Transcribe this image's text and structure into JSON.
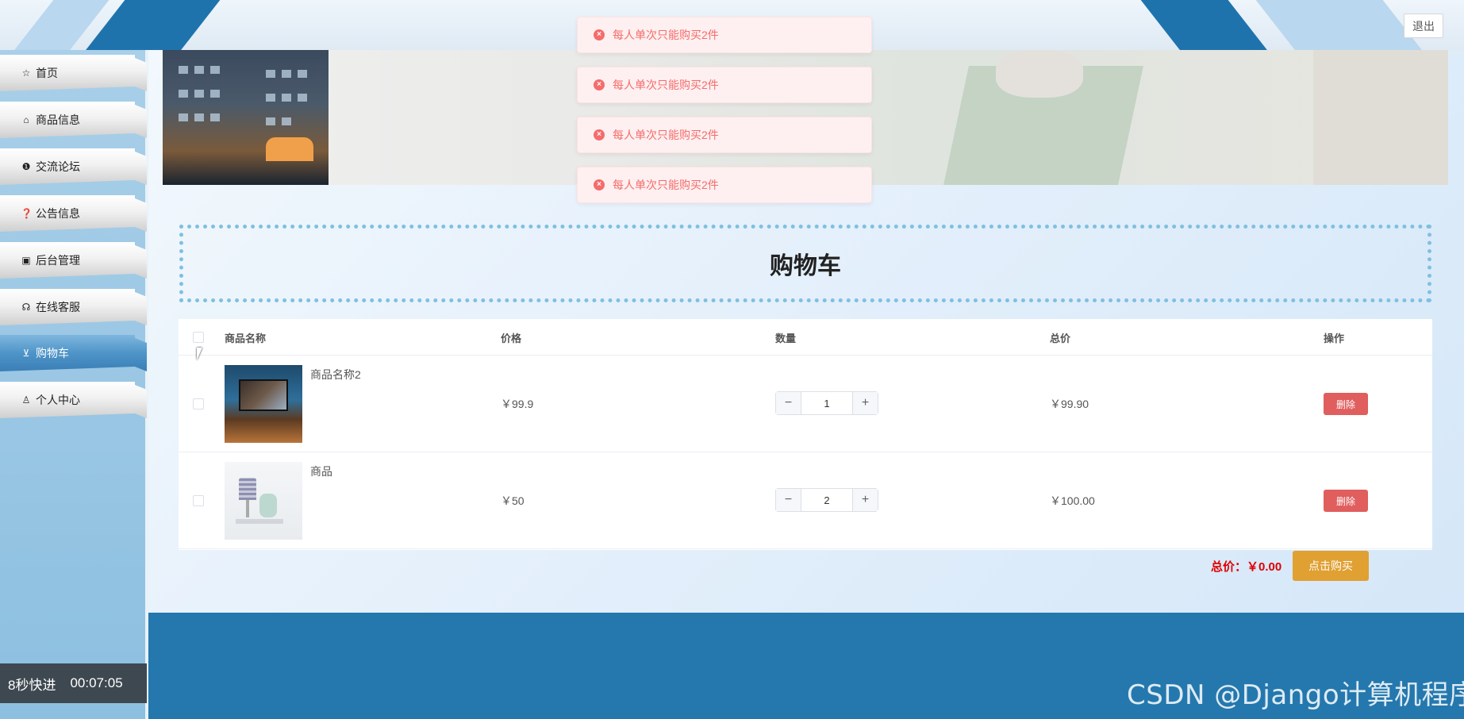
{
  "header": {
    "logout_label": "退出"
  },
  "sidebar": {
    "items": [
      {
        "label": "首页",
        "icon": "home-icon",
        "glyph": "☆"
      },
      {
        "label": "商品信息",
        "icon": "bag-icon",
        "glyph": "⌂"
      },
      {
        "label": "交流论坛",
        "icon": "info-icon",
        "glyph": "❶"
      },
      {
        "label": "公告信息",
        "icon": "question-icon",
        "glyph": "❓"
      },
      {
        "label": "后台管理",
        "icon": "briefcase-icon",
        "glyph": "▣"
      },
      {
        "label": "在线客服",
        "icon": "headset-icon",
        "glyph": "☊"
      },
      {
        "label": "购物车",
        "icon": "cart-icon",
        "glyph": "⊻"
      },
      {
        "label": "个人中心",
        "icon": "user-icon",
        "glyph": "♙"
      }
    ],
    "active_index": 6
  },
  "toasts": [
    {
      "text": "每人单次只能购买2件"
    },
    {
      "text": "每人单次只能购买2件"
    },
    {
      "text": "每人单次只能购买2件"
    },
    {
      "text": "每人单次只能购买2件"
    }
  ],
  "page": {
    "title": "购物车"
  },
  "table": {
    "headers": [
      "商品名称",
      "价格",
      "数量",
      "总价",
      "操作"
    ],
    "rows": [
      {
        "name": "商品名称2",
        "price": "￥99.9",
        "quantity": "1",
        "total": "￥99.90",
        "delete_label": "删除"
      },
      {
        "name": "商品",
        "price": "￥50",
        "quantity": "2",
        "total": "￥100.00",
        "delete_label": "删除"
      }
    ]
  },
  "summary": {
    "total_label": "总价：￥0.00",
    "buy_label": "点击购买"
  },
  "overlay": {
    "speed_text": "8秒快进",
    "time_text": "00:07:05"
  },
  "watermark": {
    "text": "CSDN @Django计算机程序"
  },
  "colors": {
    "accent": "#2478ae",
    "error": "#f56c6c",
    "delete": "#e05e5e",
    "buy": "#e1a032"
  }
}
